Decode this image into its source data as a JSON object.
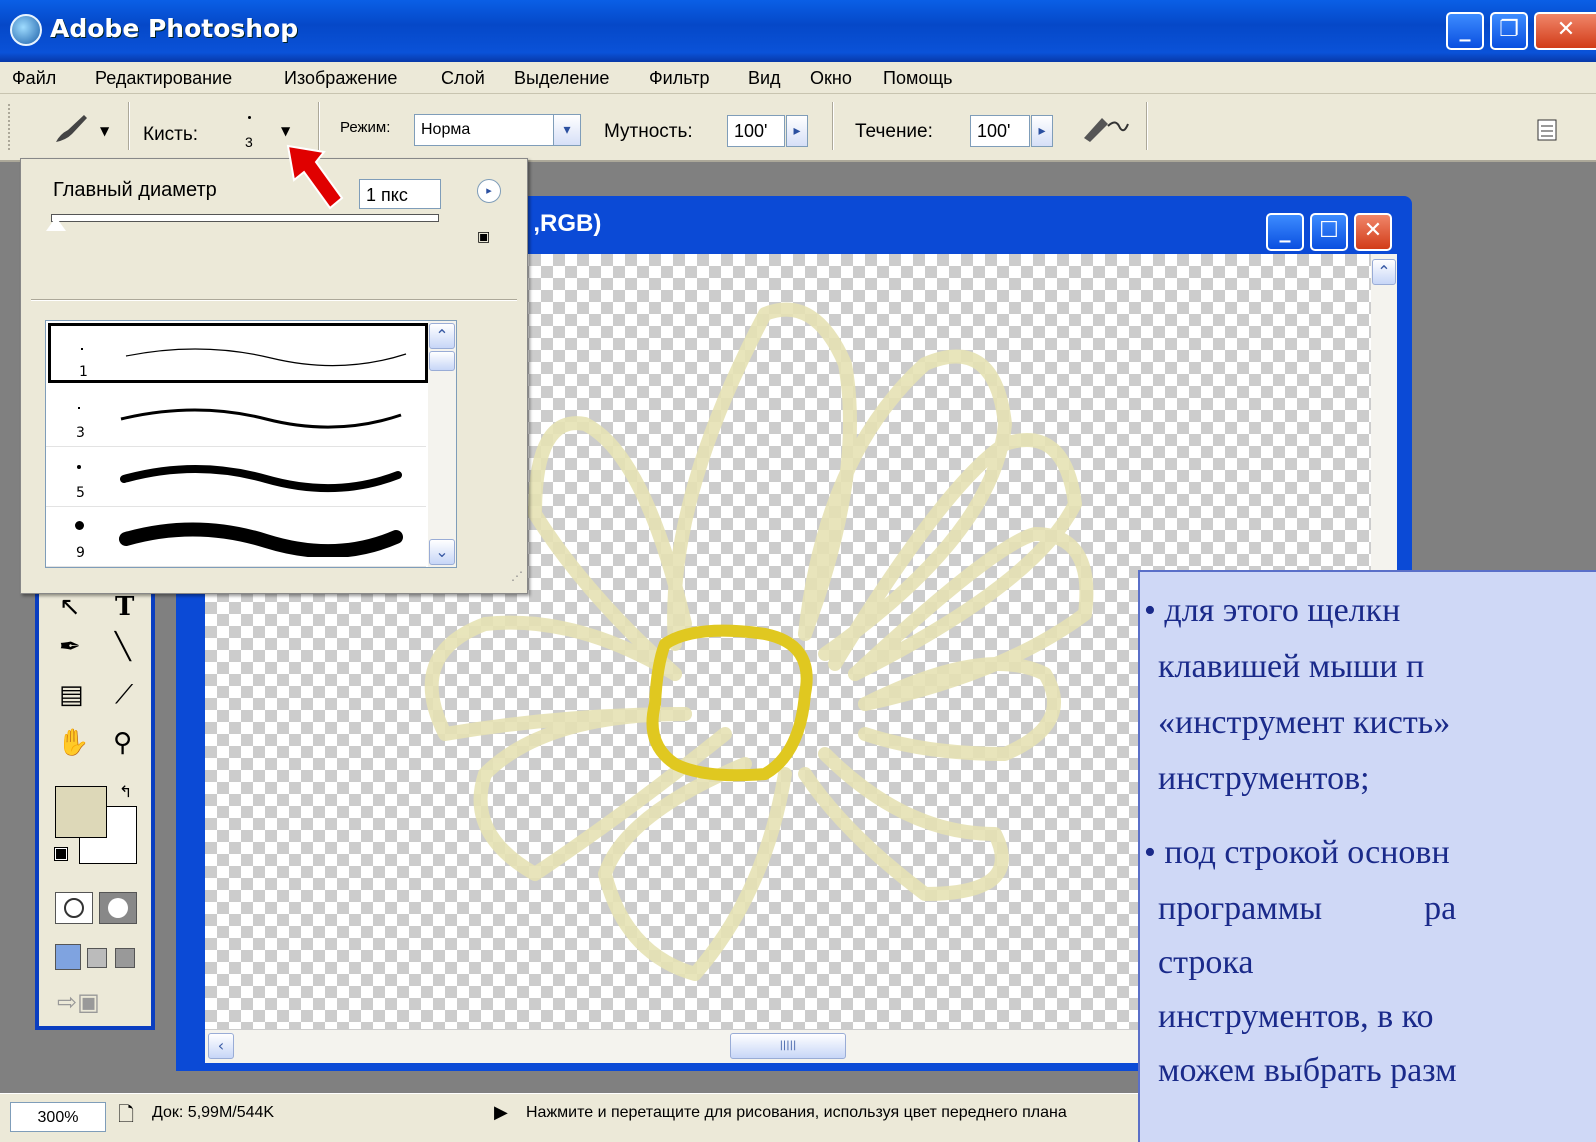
{
  "window": {
    "title": "Adobe Photoshop",
    "minimize": "_",
    "restore": "❐",
    "close": "✕"
  },
  "menu": [
    "Файл",
    "Редактирование",
    "Изображение",
    "Слой",
    "Выделение",
    "Фильтр",
    "Вид",
    "Окно",
    "Помощь"
  ],
  "options": {
    "brush_label": "Кисть:",
    "brush_size": "3",
    "mode_label": "Режим:",
    "mode_value": "Норма",
    "opacity_label": "Мутность:",
    "opacity_value": "100'",
    "flow_label": "Течение:",
    "flow_value": "100'"
  },
  "brush_popup": {
    "diameter_label": "Главный диаметр",
    "diameter_value": "1 пкс",
    "presets": [
      {
        "size": "1"
      },
      {
        "size": "3"
      },
      {
        "size": "5"
      },
      {
        "size": "9"
      }
    ]
  },
  "document": {
    "title_fragment": "l ,RGB)"
  },
  "status": {
    "zoom": "300%",
    "doc_info": "Док: 5,99M/544K",
    "hint": "Нажмите и перетащите для рисования, используя цвет переднего плана"
  },
  "slide_text": {
    "lines": [
      "• для этого щелкн",
      "клавишей мыши п",
      "«инструмент кисть»",
      "инструментов;",
      "• под строкой основн",
      "программы            ра",
      "строка",
      "инструментов, в ко",
      "можем выбрать разм"
    ]
  },
  "colors": {
    "title_blue": "#0a52d8",
    "chrome": "#ece9d8",
    "slide_bg": "#cfd8f6",
    "slide_text": "#1a2a8a",
    "arrow_red": "#e00000",
    "flower": "#e6e2b4",
    "flower_center": "#e0c820"
  }
}
